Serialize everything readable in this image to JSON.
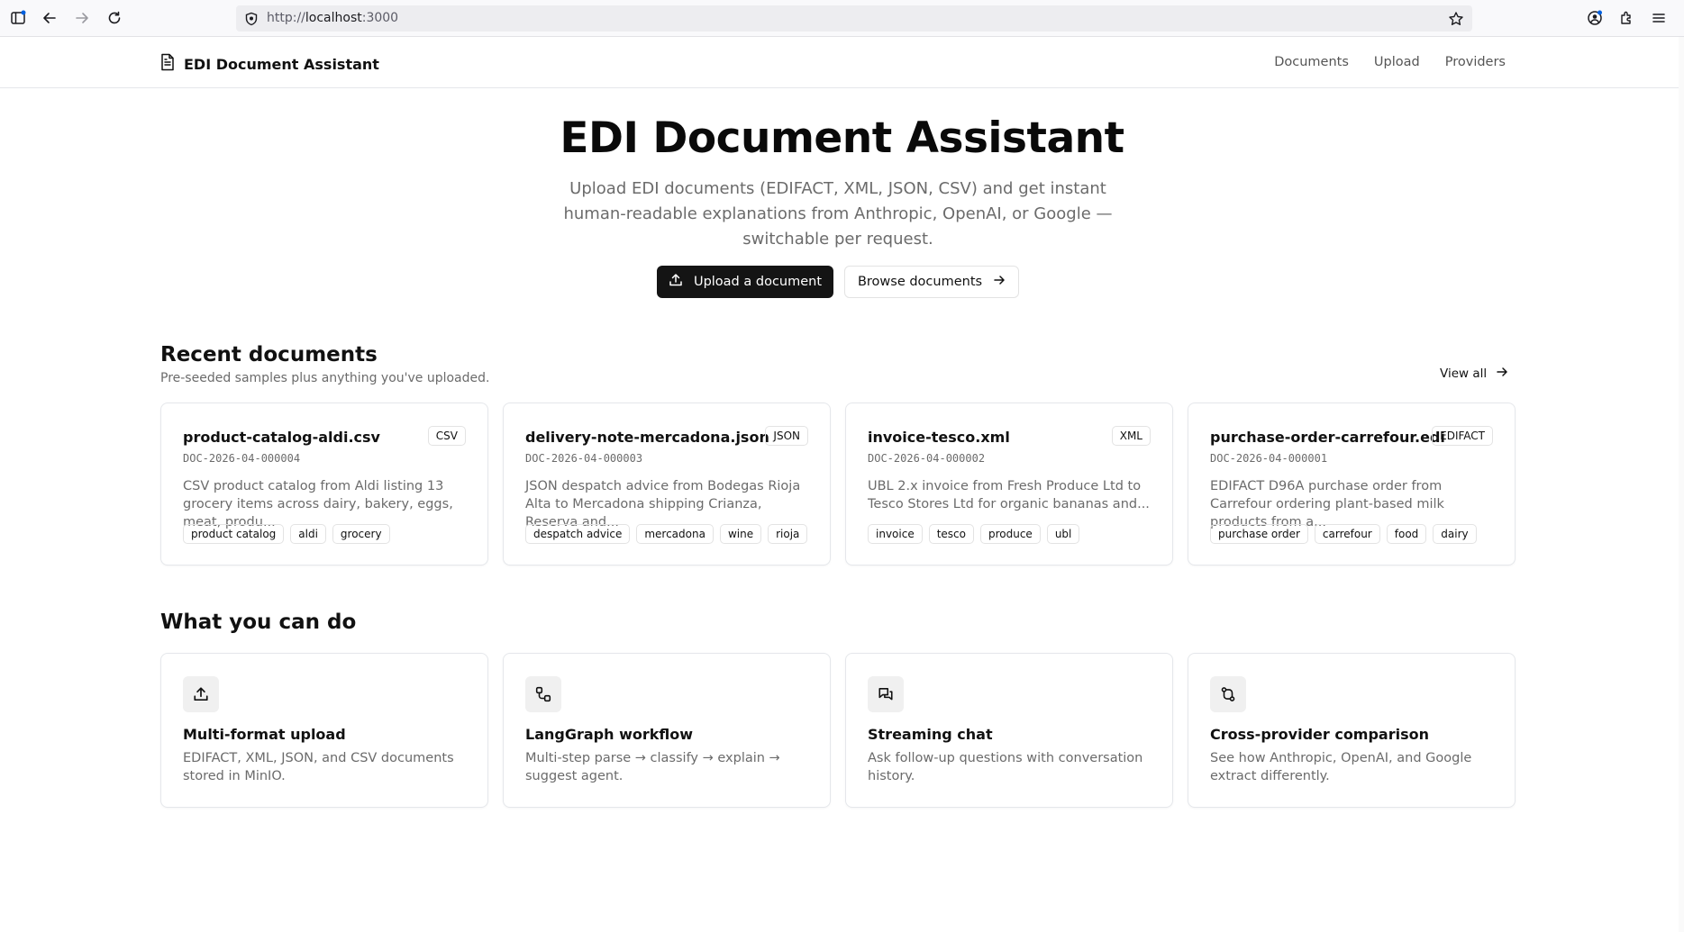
{
  "browser": {
    "url_prefix": "http://",
    "url_host": "localhost",
    "url_port": ":3000"
  },
  "header": {
    "brand": "EDI Document Assistant",
    "nav": [
      "Documents",
      "Upload",
      "Providers"
    ]
  },
  "hero": {
    "title": "EDI Document Assistant",
    "subtitle": "Upload EDI documents (EDIFACT, XML, JSON, CSV) and get instant human-readable explanations from Anthropic, OpenAI, or Google — switchable per request.",
    "primary_button": "Upload a document",
    "secondary_button": "Browse documents"
  },
  "recent": {
    "title": "Recent documents",
    "subtitle": "Pre-seeded samples plus anything you've uploaded.",
    "view_all": "View all",
    "documents": [
      {
        "name": "product-catalog-aldi.csv",
        "badge": "CSV",
        "id": "DOC-2026-04-000004",
        "desc": "CSV product catalog from Aldi listing 13 grocery items across dairy, bakery, eggs, meat, produ...",
        "tags": [
          "product catalog",
          "aldi",
          "grocery"
        ]
      },
      {
        "name": "delivery-note-mercadona.json",
        "badge": "JSON",
        "id": "DOC-2026-04-000003",
        "desc": "JSON despatch advice from Bodegas Rioja Alta to Mercadona shipping Crianza, Reserva and...",
        "tags": [
          "despatch advice",
          "mercadona",
          "wine",
          "rioja"
        ]
      },
      {
        "name": "invoice-tesco.xml",
        "badge": "XML",
        "id": "DOC-2026-04-000002",
        "desc": "UBL 2.x invoice from Fresh Produce Ltd to Tesco Stores Ltd for organic bananas and...",
        "tags": [
          "invoice",
          "tesco",
          "produce",
          "ubl"
        ]
      },
      {
        "name": "purchase-order-carrefour.edi",
        "badge": "EDIFACT",
        "id": "DOC-2026-04-000001",
        "desc": "EDIFACT D96A purchase order from Carrefour ordering plant-based milk products from a...",
        "tags": [
          "purchase order",
          "carrefour",
          "food",
          "dairy"
        ]
      }
    ]
  },
  "features": {
    "title": "What you can do",
    "items": [
      {
        "icon": "upload-icon",
        "title": "Multi-format upload",
        "desc": "EDIFACT, XML, JSON, and CSV documents stored in MinIO."
      },
      {
        "icon": "workflow-icon",
        "title": "LangGraph workflow",
        "desc": "Multi-step parse → classify → explain → suggest agent."
      },
      {
        "icon": "chat-icon",
        "title": "Streaming chat",
        "desc": "Ask follow-up questions with conversation history."
      },
      {
        "icon": "compare-icon",
        "title": "Cross-provider comparison",
        "desc": "See how Anthropic, OpenAI, and Google extract differently."
      }
    ]
  }
}
